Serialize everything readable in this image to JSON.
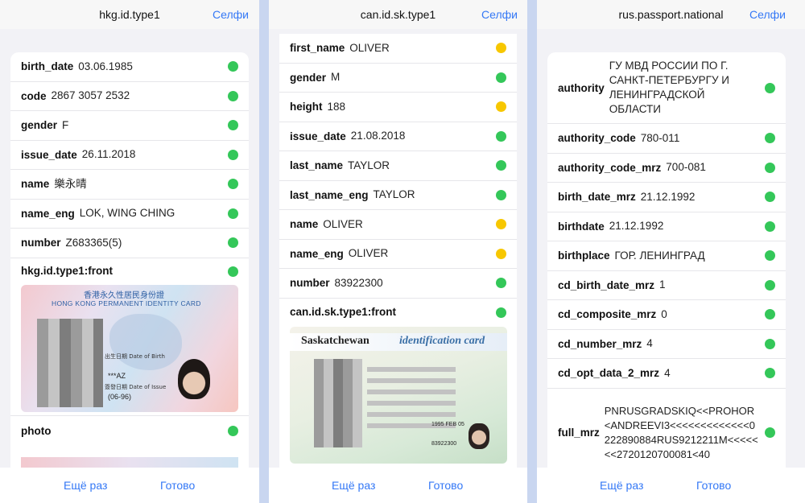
{
  "panels": [
    {
      "title": "hkg.id.type1",
      "action": "Селфи",
      "rows": [
        {
          "key": "birth_date",
          "value": "03.06.1985",
          "status": "green"
        },
        {
          "key": "code",
          "value": "2867 3057 2532",
          "status": "green"
        },
        {
          "key": "gender",
          "value": "F",
          "status": "green"
        },
        {
          "key": "issue_date",
          "value": "26.11.2018",
          "status": "green"
        },
        {
          "key": "name",
          "value": "樂永晴",
          "status": "green"
        },
        {
          "key": "name_eng",
          "value": "LOK, WING CHING",
          "status": "green"
        },
        {
          "key": "number",
          "value": "Z683365(5)",
          "status": "green"
        },
        {
          "key": "hkg.id.type1:front",
          "value": "",
          "status": "green"
        },
        {
          "key": "photo",
          "value": "",
          "status": "green"
        }
      ],
      "card": {
        "title_zh": "香港永久性居民身份證",
        "title_en": "HONG KONG PERMANENT IDENTITY CARD",
        "dob_label": "出生日期 Date of Birth",
        "code": "***AZ",
        "issue_label": "簽發日期 Date of Issue",
        "issue": "(06-96)"
      },
      "footer": {
        "retry": "Ещё раз",
        "done": "Готово"
      }
    },
    {
      "title": "can.id.sk.type1",
      "action": "Селфи",
      "rows": [
        {
          "key": "first_name",
          "value": "OLIVER",
          "status": "yellow"
        },
        {
          "key": "gender",
          "value": "M",
          "status": "green"
        },
        {
          "key": "height",
          "value": "188",
          "status": "yellow"
        },
        {
          "key": "issue_date",
          "value": "21.08.2018",
          "status": "green"
        },
        {
          "key": "last_name",
          "value": "TAYLOR",
          "status": "green"
        },
        {
          "key": "last_name_eng",
          "value": "TAYLOR",
          "status": "green"
        },
        {
          "key": "name",
          "value": "OLIVER",
          "status": "yellow"
        },
        {
          "key": "name_eng",
          "value": "OLIVER",
          "status": "yellow"
        },
        {
          "key": "number",
          "value": "83922300",
          "status": "green"
        },
        {
          "key": "can.id.sk.type1:front",
          "value": "",
          "status": "green"
        }
      ],
      "card": {
        "province": "Saskatchewan",
        "title": "identification card",
        "dob": "1995 FEB 05",
        "number": "83922300"
      },
      "footer": {
        "retry": "Ещё раз",
        "done": "Готово"
      }
    },
    {
      "title": "rus.passport.national",
      "action": "Селфи",
      "rows": [
        {
          "key": "authority",
          "value": "ГУ МВД РОССИИ ПО Г. САНКТ-ПЕТЕРБУРГУ И ЛЕНИНГРАДСКОЙ ОБЛАСТИ",
          "status": "green"
        },
        {
          "key": "authority_code",
          "value": "780-011",
          "status": "green"
        },
        {
          "key": "authority_code_mrz",
          "value": "700-081",
          "status": "green"
        },
        {
          "key": "birth_date_mrz",
          "value": "21.12.1992",
          "status": "green"
        },
        {
          "key": "birthdate",
          "value": "21.12.1992",
          "status": "green"
        },
        {
          "key": "birthplace",
          "value": "ГОР. ЛЕНИНГРАД",
          "status": "green"
        },
        {
          "key": "cd_birth_date_mrz",
          "value": "1",
          "status": "green"
        },
        {
          "key": "cd_composite_mrz",
          "value": "0",
          "status": "green"
        },
        {
          "key": "cd_number_mrz",
          "value": "4",
          "status": "green"
        },
        {
          "key": "cd_opt_data_2_mrz",
          "value": "4",
          "status": "green"
        },
        {
          "key": "full_mrz",
          "value": "PNRUSGRADSKIQ<<PROHOR<ANDREEVI3<<<<<<<<<<<<<0222890884RUS9212211M<<<<<<<2720120700081<40",
          "status": "green"
        }
      ],
      "footer": {
        "retry": "Ещё раз",
        "done": "Готово"
      }
    }
  ],
  "colors": {
    "green": "#34c759",
    "yellow": "#f7c700",
    "accent": "#3478f6"
  }
}
